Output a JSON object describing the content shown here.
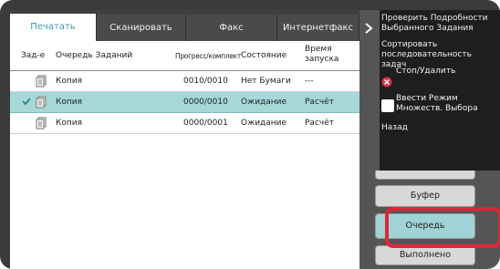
{
  "tabs": [
    {
      "label": "Печатать"
    },
    {
      "label": "Сканировать"
    },
    {
      "label": "Факс"
    },
    {
      "label": "Интернетфакс"
    }
  ],
  "table": {
    "headers": {
      "status": "Зад-е",
      "queue": "Очередь Заданий",
      "progress": "Прогресс/комплект",
      "state": "Состояние",
      "time": "Время запуска"
    },
    "rows": [
      {
        "name": "Копия",
        "progress": "0010/0010",
        "state": "Нет Бумаги",
        "time": "---"
      },
      {
        "name": "Копия",
        "progress": "0000/0010",
        "state": "Ожидание",
        "time": "Расчёт"
      },
      {
        "name": "Копия",
        "progress": "0000/0001",
        "state": "Ожидание",
        "time": "Расчёт"
      }
    ]
  },
  "menu": {
    "item1": "Проверить Подробности Выбранного Задания",
    "item2": "Сортировать последовательность задач",
    "item3": "Стоп/Удалить",
    "item4": "Ввести Режим Множеств. Выбора",
    "item5": "Назад"
  },
  "side_buttons": {
    "buffer": "Буфер",
    "queue": "Очередь",
    "done": "Выполнено"
  },
  "colors": {
    "accent": "#3a9bb0",
    "selected_row": "#a7d8d8",
    "highlight_ring": "#e2243a",
    "menu_bg": "#1e1e1e"
  }
}
